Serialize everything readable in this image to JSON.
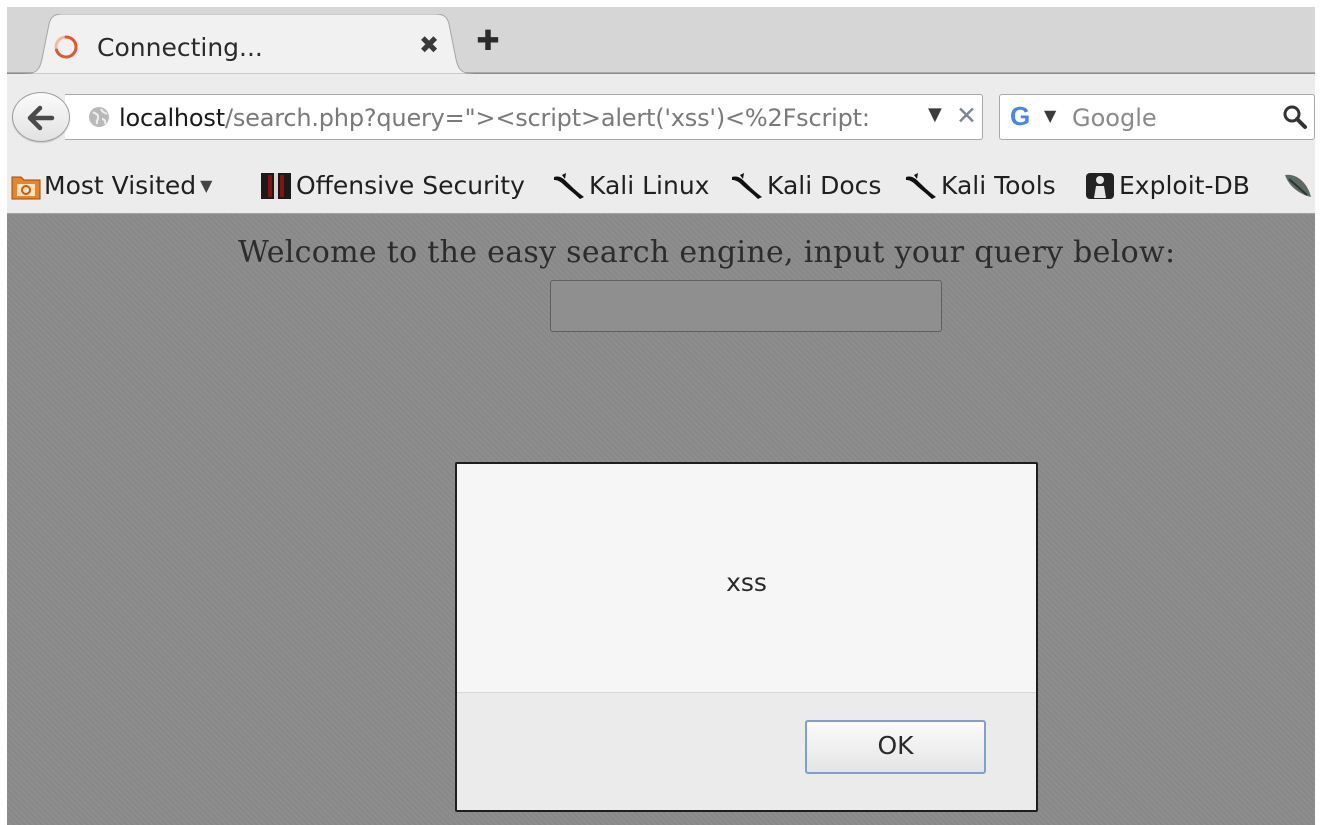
{
  "browser": {
    "tab": {
      "title": "Connecting...",
      "close_glyph": "✖"
    },
    "new_tab_glyph": "✚",
    "url": {
      "host": "localhost",
      "path": "/search.php?query=\"><script>alert('xss')<%2Fscript:",
      "dropdown_glyph": "▼",
      "clear_glyph": "✕"
    },
    "search": {
      "engine_logo": "G",
      "dropdown_glyph": "▼",
      "placeholder": "Google"
    },
    "bookmarks": [
      {
        "label": "Most Visited",
        "icon": "folder-rss-icon",
        "has_dropdown": true,
        "arrow": "▼"
      },
      {
        "label": "Offensive Security",
        "icon": "offsec-logo-icon"
      },
      {
        "label": "Kali Linux",
        "icon": "kali-dragon-icon"
      },
      {
        "label": "Kali Docs",
        "icon": "kali-dragon-icon"
      },
      {
        "label": "Kali Tools",
        "icon": "kali-dragon-icon"
      },
      {
        "label": "Exploit-DB",
        "icon": "exploitdb-icon"
      }
    ]
  },
  "page": {
    "welcome_text": "Welcome to the easy search engine, input your query below:",
    "query_value": ""
  },
  "alert": {
    "message": "xss",
    "ok_label": "OK"
  },
  "colors": {
    "tab_strip": "#d6d6d6",
    "toolbar": "#ececec",
    "page_overlay": "#8c8c8c",
    "dialog_bg": "#f6f6f6",
    "ok_focus_border": "#7fa0c8",
    "spinner": "#e8572b"
  }
}
